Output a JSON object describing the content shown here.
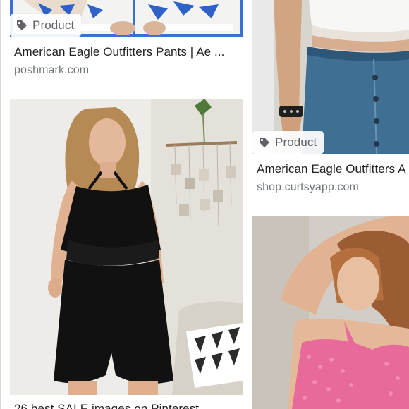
{
  "results": [
    {
      "badge": "Product",
      "title": "American Eagle Outfitters Pants | Ae ...",
      "source": "poshmark.com",
      "image": "white top and blue floral shorts"
    },
    {
      "badge": "Product",
      "title": "American Eagle Outfitters A",
      "source": "shop.curtsyapp.com",
      "image": "denim skirt with white crop top"
    },
    {
      "title": "26 best SALE images on Pinterest",
      "image": "black halter romper"
    },
    {
      "image": "pink crochet halter top"
    }
  ],
  "icons": {
    "badge_icon": "tag-icon"
  },
  "colors": {
    "title": "#202124",
    "source": "#70757a",
    "badge_text": "#5f6368",
    "romper": "#111111",
    "pink_top": "#e86a9a",
    "denim": "#3f6f93",
    "floral_blue": "#2f62c9"
  }
}
